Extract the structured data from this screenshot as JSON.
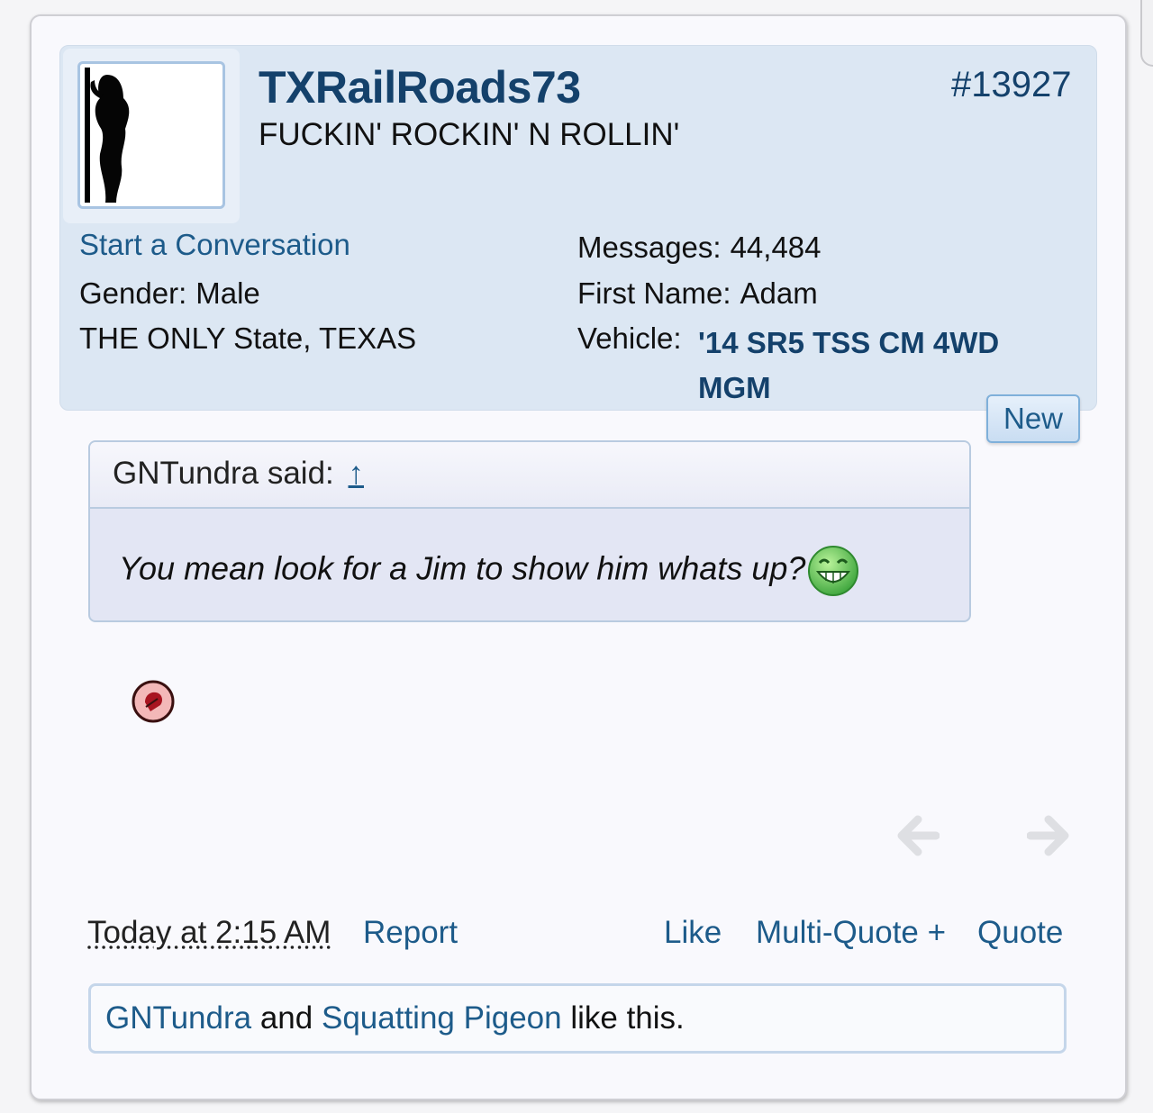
{
  "post": {
    "username": "TXRailRoads73",
    "user_title": "FUCKIN' ROCKIN' N ROLLIN'",
    "post_number": "#13927",
    "start_conversation": "Start a Conversation",
    "gender_label": "Gender:",
    "gender_value": "Male",
    "location": "THE ONLY State, TEXAS",
    "messages_label": "Messages:",
    "messages_value": "44,484",
    "first_name_label": "First Name:",
    "first_name_value": "Adam",
    "vehicle_label": "Vehicle:",
    "vehicle_value": "'14 SR5 TSS CM 4WD MGM",
    "new_badge": "New"
  },
  "quote": {
    "attribution": "GNTundra said:",
    "jump_arrow": "↑",
    "text": "You mean look for a Jim to show him whats up?",
    "emoji_icon": "grin-smiley-icon"
  },
  "footer": {
    "timestamp": "Today at 2:15 AM",
    "report": "Report",
    "like": "Like",
    "multi_quote": "Multi-Quote +",
    "quote": "Quote"
  },
  "likes": {
    "user1": "GNTundra",
    "and": "and",
    "user2": "Squatting Pigeon",
    "suffix": "like this."
  },
  "colors": {
    "link": "#1d5b8a",
    "username": "#14416b",
    "panel_bg": "#dce7f3"
  }
}
